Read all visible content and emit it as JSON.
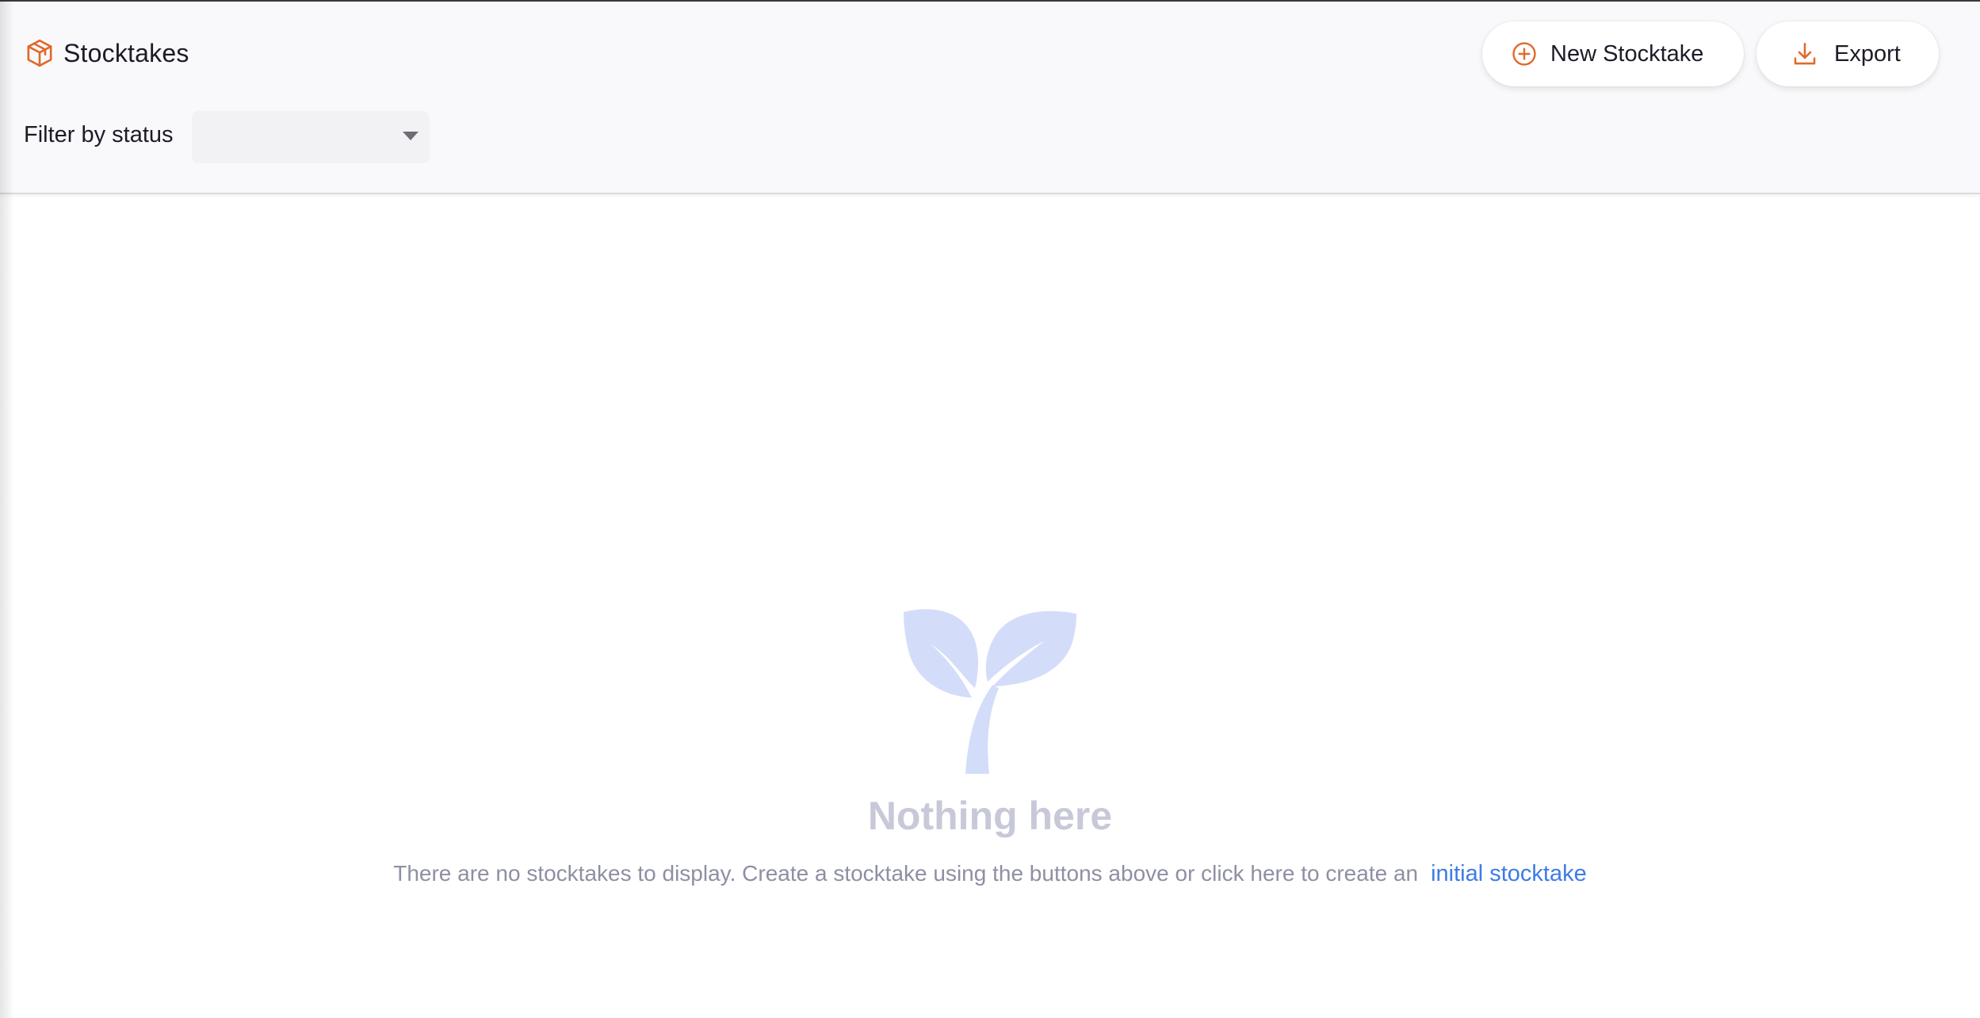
{
  "header": {
    "title": "Stocktakes",
    "title_icon": "package-box-icon",
    "buttons": {
      "new_stocktake": {
        "label": "New Stocktake",
        "icon": "plus-circle-icon"
      },
      "export": {
        "label": "Export",
        "icon": "download-icon"
      }
    },
    "filter": {
      "label": "Filter by status",
      "selected_value": ""
    }
  },
  "empty_state": {
    "icon": "sprout-icon",
    "title": "Nothing here",
    "message": "There are no stocktakes to display. Create a stocktake using the buttons above or click here to create an",
    "link_label": "initial stocktake"
  },
  "colors": {
    "accent": "#e06a2c",
    "link": "#3e7be6",
    "empty_icon": "#d3ddfa",
    "empty_title": "#c7c9d9",
    "header_bg": "#f9f9fb"
  }
}
